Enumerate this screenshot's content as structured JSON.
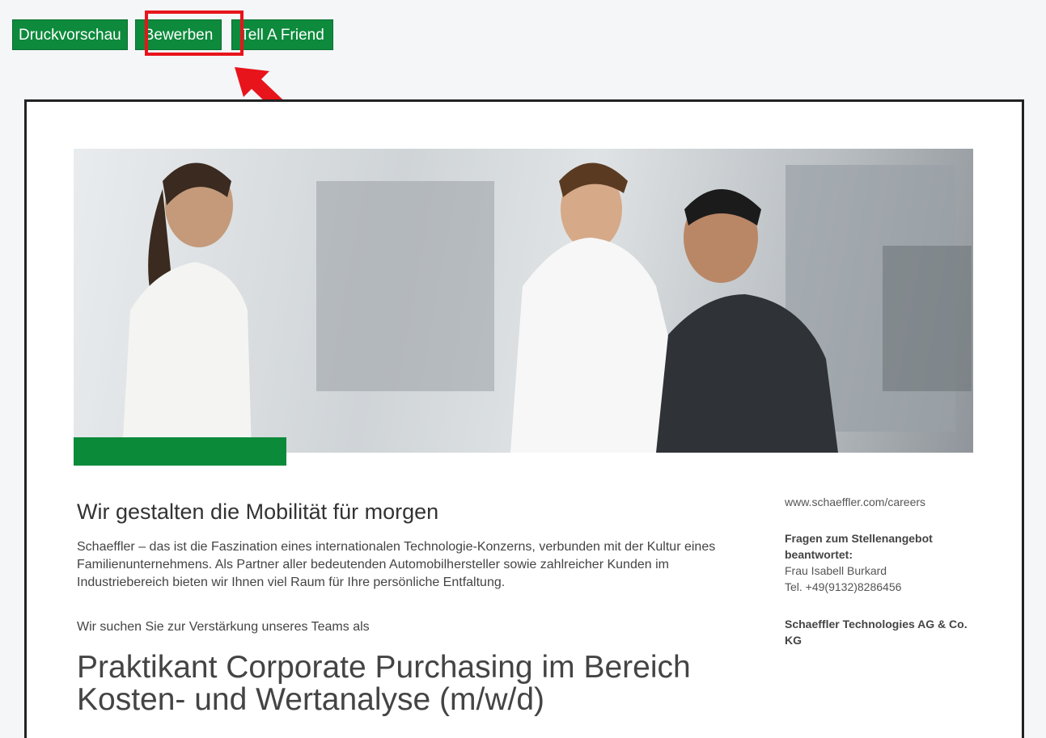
{
  "toolbar": {
    "print_label": "Druckvorschau",
    "apply_label": "Bewerben",
    "tell_label": "Tell A Friend"
  },
  "colors": {
    "accent_green": "#0d8a3c",
    "highlight_red": "#e8141b"
  },
  "hero": {
    "alt_icon": "photo-three-people-factory"
  },
  "content": {
    "headline": "Wir gestalten die Mobilität für morgen",
    "intro": "Schaeffler – das ist die Faszination eines internationalen Technologie-Konzerns, verbunden mit der Kultur eines Familienunternehmens. Als Partner aller bedeutenden Automobilhersteller sowie zahlreicher Kunden im Industriebereich bieten wir Ihnen viel Raum für Ihre persönliche Entfaltung.",
    "lead": "Wir suchen Sie zur Verstärkung unseres Teams als",
    "job_title": "Praktikant Corporate Purchasing im Bereich Kosten- und Wertanalyse (m/w/d)"
  },
  "sidebar": {
    "url": "www.schaeffler.com/careers",
    "questions_label": "Fragen zum Stellenangebot beantwortet:",
    "contact_name": "Frau Isabell Burkard",
    "contact_phone": "Tel. +49(9132)8286456",
    "company": "Schaeffler Technologies AG & Co. KG"
  }
}
